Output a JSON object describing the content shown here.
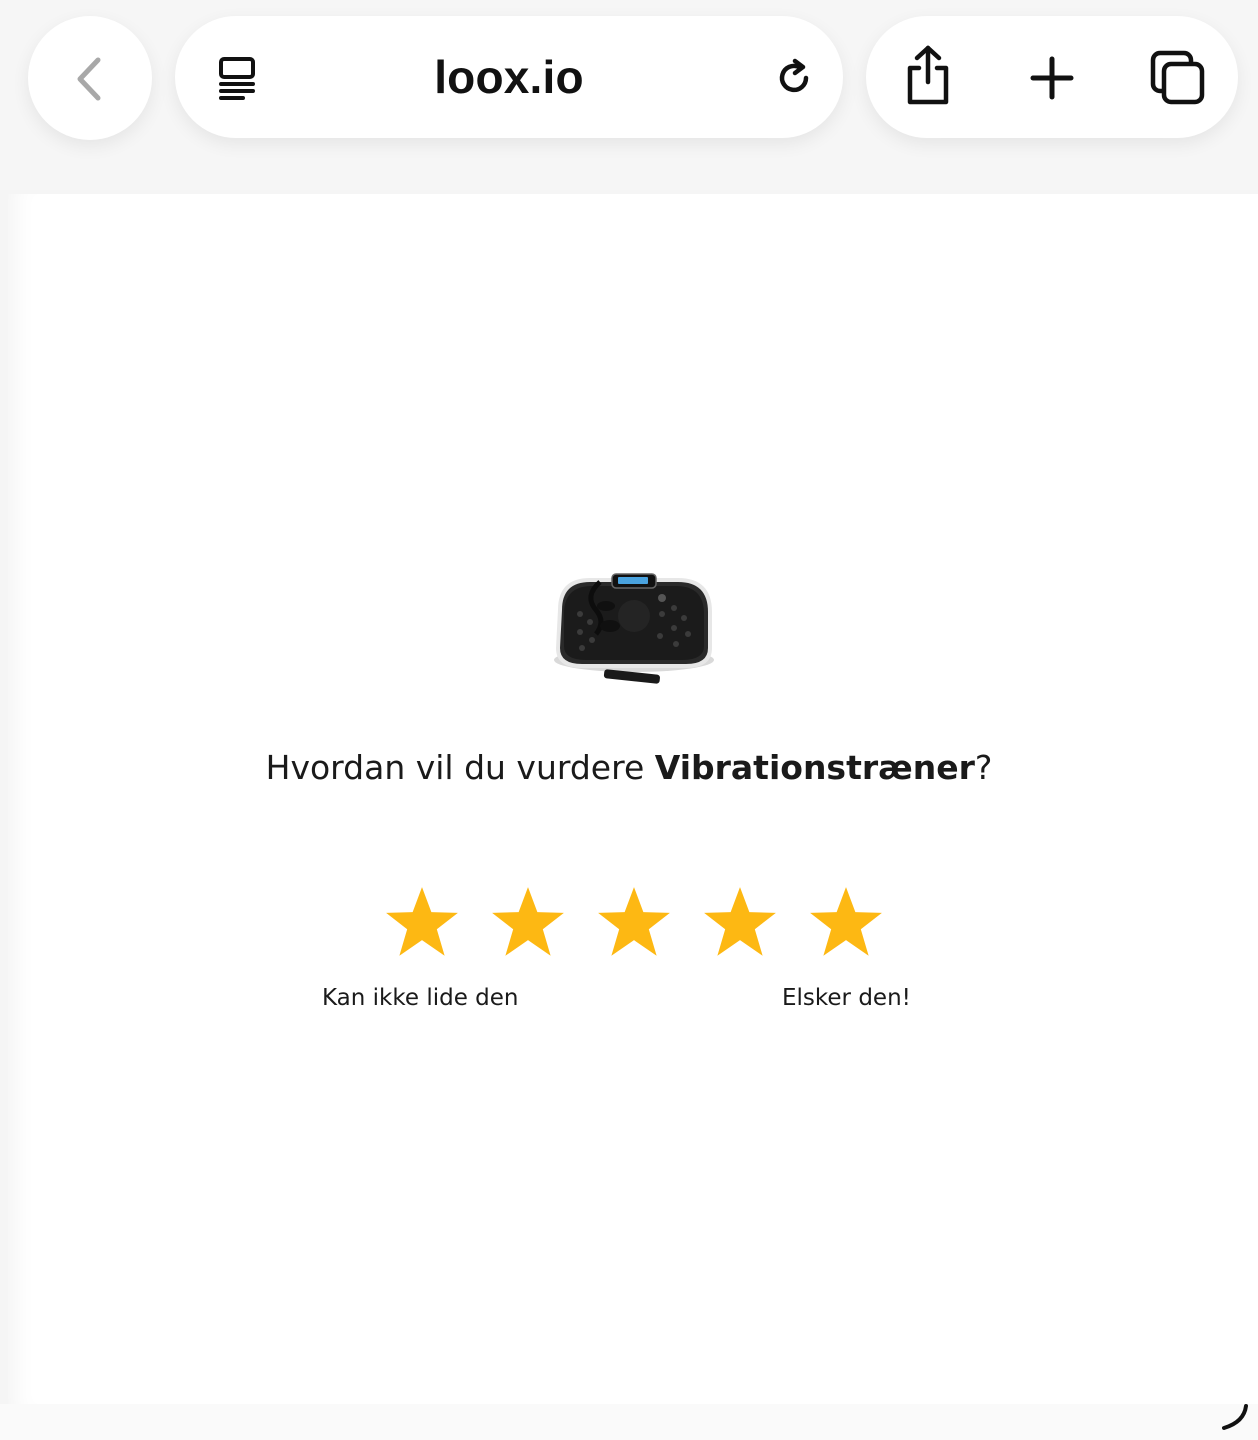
{
  "browser": {
    "url": "loox.io",
    "icons": {
      "back": "chevron-left-icon",
      "reader": "reader-mode-icon",
      "reload": "reload-icon",
      "share": "share-icon",
      "new_tab": "plus-icon",
      "tabs": "tabs-icon"
    }
  },
  "review": {
    "product_image": "vibration-plate-product-image",
    "question_prefix": "Hvordan vil du vurdere ",
    "product_name": "Vibrationstræner",
    "question_suffix": "?",
    "rating_max": 5,
    "star_color": "#FDB813",
    "label_low": "Kan ikke lide den",
    "label_high": "Elsker den!"
  },
  "colors": {
    "toolbar_bg": "#f6f6f6",
    "page_bg": "#ffffff",
    "text": "#1a1a1a"
  }
}
